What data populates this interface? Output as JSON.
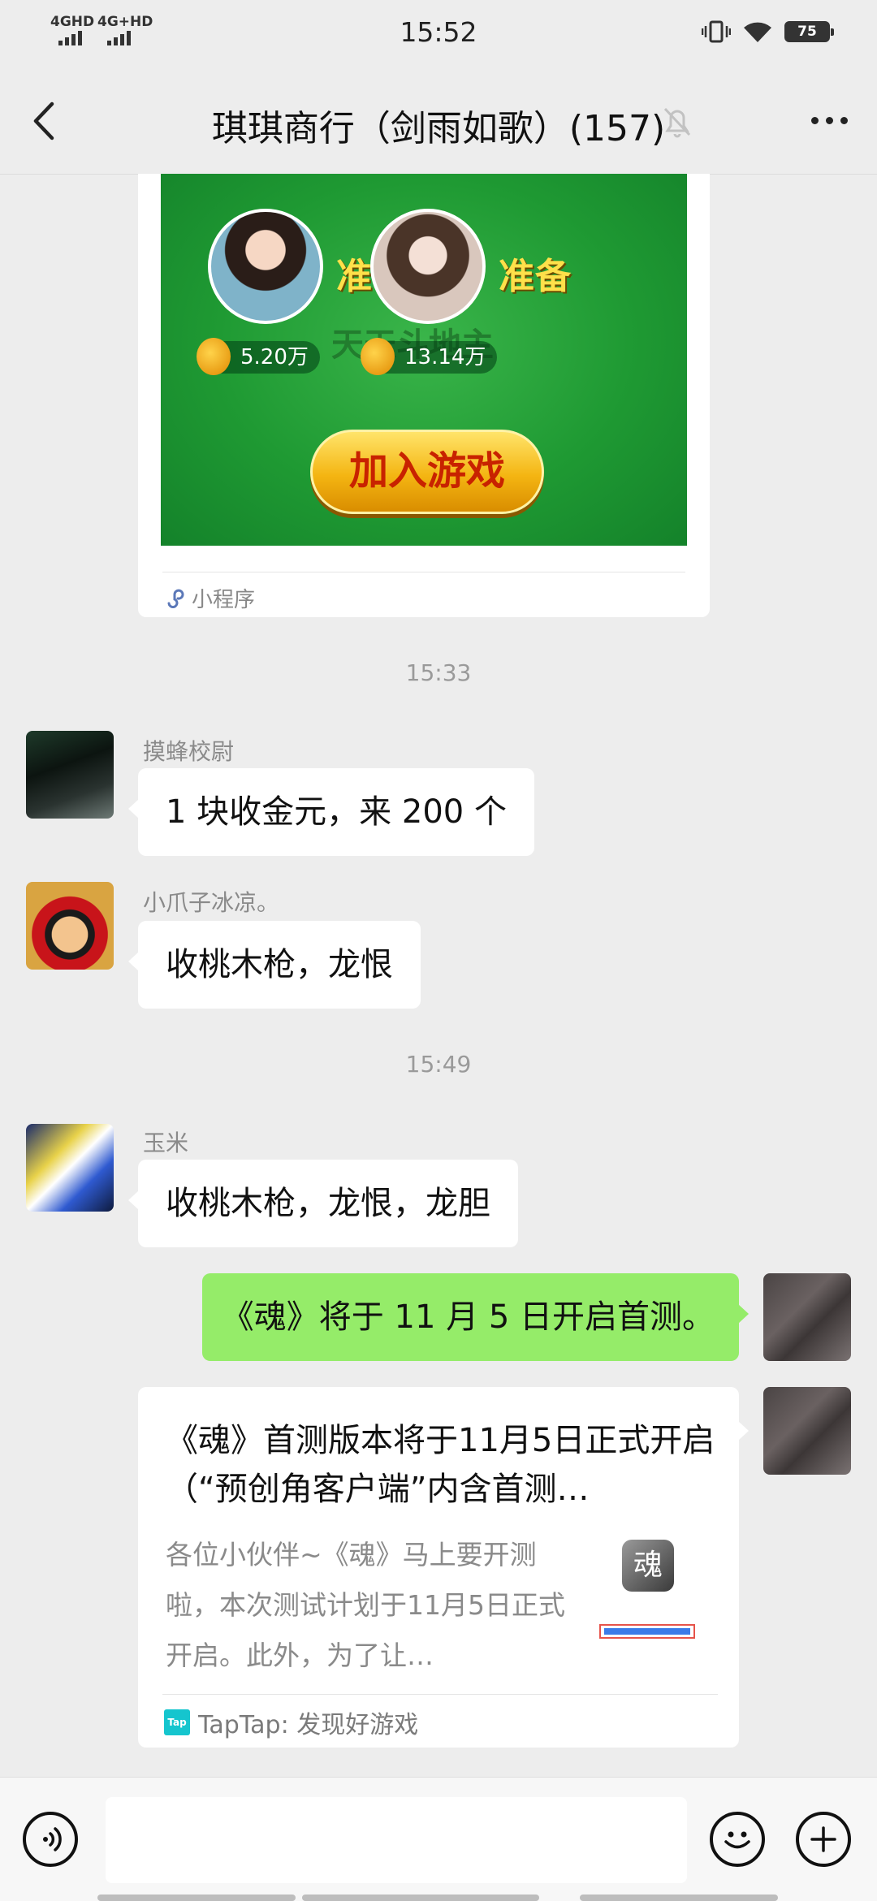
{
  "status_bar": {
    "network_1": "4GHD",
    "network_2": "4G+HD",
    "time": "15:52",
    "battery": "75"
  },
  "header": {
    "title": "琪琪商行（剑雨如歌）(157)"
  },
  "mini_program": {
    "player1_coins": "5.20万",
    "player2_coins": "13.14万",
    "ready_label": "准备",
    "watermark": "天天斗地主",
    "join_label": "加入游戏",
    "source_label": "小程序"
  },
  "timestamps": [
    "15:33",
    "15:49"
  ],
  "messages": [
    {
      "sender": "摸蜂校尉",
      "text": "1 块收金元，来 200 个"
    },
    {
      "sender": "小爪子冰凉。",
      "text": "收桃木枪，龙恨"
    },
    {
      "sender": "玉米",
      "text": "收桃木枪，龙恨，龙胆"
    },
    {
      "sender": "",
      "text": "《魂》将于 11 月 5 日开启首测。"
    }
  ],
  "link_card": {
    "title": "《魂》首测版本将于11月5日正式开启（“预创角客户端”内含首测…",
    "description": "各位小伙伴~《魂》马上要开测啦，本次测试计划于11月5日正式开启。此外，为了让…",
    "source": "TapTap: 发现好游戏",
    "thumb_text": "魂"
  },
  "colors": {
    "chat_bg": "#ededed",
    "my_bubble": "#95ec69",
    "other_bubble": "#ffffff",
    "taptap": "#15c5ce"
  }
}
